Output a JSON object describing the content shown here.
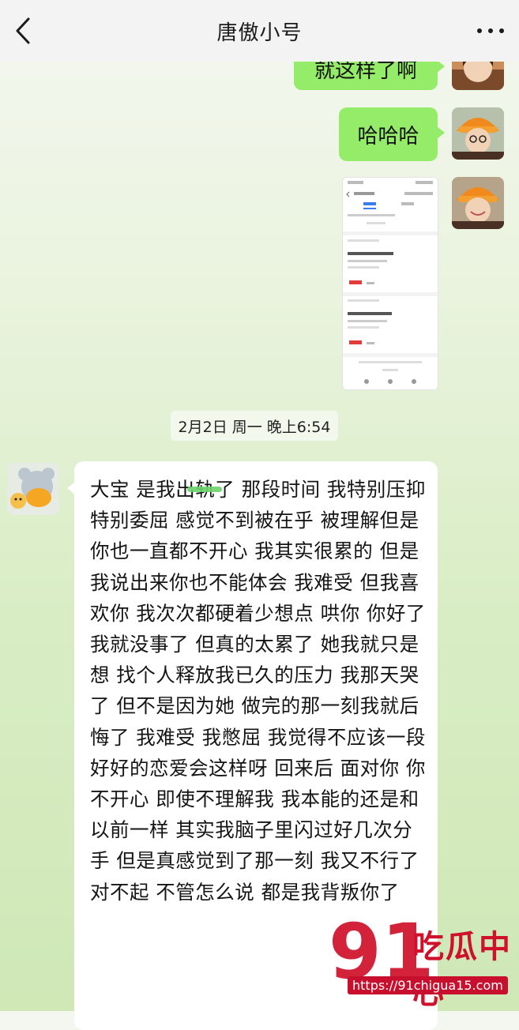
{
  "header": {
    "title": "唐傲小号"
  },
  "messages": {
    "green1": "就这样了啊",
    "green2": "哈哈哈",
    "timestamp": "2月2日 周一 晚上6:54",
    "long_text": "大宝 是我出轨了 那段时间 我特别压抑 特别委屈 感觉不到被在乎 被理解但是你也一直都不开心  我其实很累的  但是我说出来你也不能体会 我难受 但我喜欢你 我次次都硬着少想点 哄你 你好了我就没事了 但真的太累了 她我就只是想  找个人释放我已久的压力 我那天哭了 但不是因为她 做完的那一刻我就后悔了  我难受 我憋屈 我觉得不应该一段好好的恋爱会这样呀 回来后 面对你 你不开心  即使不理解我 我本能的还是和以前一样 其实我脑子里闪过好几次分手 但是真感觉到了那一刻 我又不行了 对不起 不管怎么说 都是我背叛你了"
  },
  "screenshot_thumb": {
    "tabs": [
      "待开票",
      "已开票"
    ],
    "train1": "G3371",
    "price1": "¥169",
    "train2": "G1523",
    "price2": "¥185"
  },
  "watermark": {
    "logo": "91",
    "name": "吃瓜中心",
    "url": "https://91chigua15.com"
  },
  "icons": [
    "back-icon",
    "more-icon"
  ],
  "colors": {
    "bubble_green": "#95ec69",
    "navbar": "#f2f3f2",
    "brand_red": "#d0112b"
  }
}
